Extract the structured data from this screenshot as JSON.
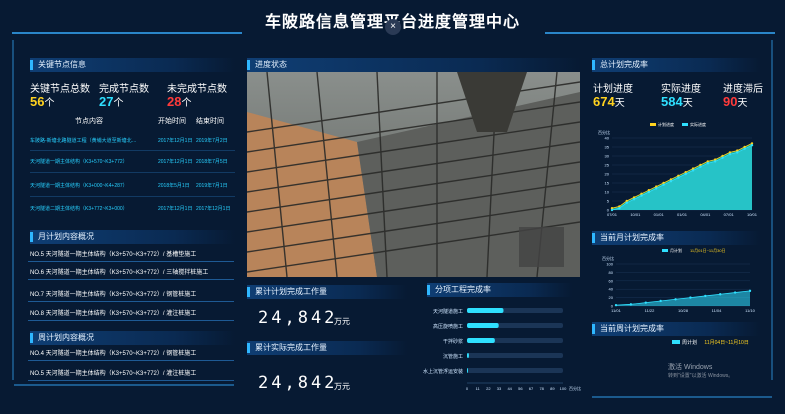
{
  "page": {
    "title": "车陂路信息管理平台进度管理中心",
    "close_glyph": "×"
  },
  "key_nodes": {
    "header": "关键节点信息",
    "stats": [
      {
        "label": "关键节点总数",
        "value": "56",
        "unit": "个",
        "color": "#ffd21f"
      },
      {
        "label": "完成节点数",
        "value": "27",
        "unit": "个",
        "color": "#2fe0ff"
      },
      {
        "label": "未完成节点数",
        "value": "28",
        "unit": "个",
        "color": "#ff3b3b"
      }
    ],
    "col_content": "节点内容",
    "col_start": "开始时间",
    "col_end": "结束时间",
    "rows": [
      {
        "content": "车陂路-新塘北路隧道工程（黄埔大道至新塘北…",
        "start": "2017年12月1日",
        "end": "2019年7月2日"
      },
      {
        "content": "天河隧道一期主体结构（K3+570~K3+772）",
        "start": "2017年12月1日",
        "end": "2018年7月5日"
      },
      {
        "content": "天河隧道一期主体结构（K3+000~K4+287）",
        "start": "2018年5月1日",
        "end": "2019年7月1日"
      },
      {
        "content": "天河隧道二期主体结构（K3+772~K3+000）",
        "start": "2017年12月1日",
        "end": "2017年12月1日"
      }
    ]
  },
  "monthly_plan": {
    "header": "月计划内容概况",
    "items": [
      "NO.5   天河隧道一期主体结构（K3+570~K3+772）/ 基槽垫施工",
      "NO.6   天河隧道一期主体结构（K3+570~K3+772）/ 三轴搅拌桩施工",
      "NO.7   天河隧道一期主体结构（K3+570~K3+772）/ 钢管桩施工",
      "NO.8   天河隧道一期主体结构（K3+570~K3+772）/ 灌注桩施工"
    ]
  },
  "weekly_plan": {
    "header": "周计划内容概况",
    "items": [
      "NO.4   天河隧道一期主体结构（K3+570~K3+772）/ 钢管桩施工",
      "NO.5   天河隧道一期主体结构（K3+570~K3+772）/ 灌注桩施工"
    ]
  },
  "progress_status": {
    "header": "进度状态"
  },
  "plan_workload": {
    "header": "累计计划完成工作量",
    "value": "24,842",
    "unit": "万元"
  },
  "actual_workload": {
    "header": "累计实际完成工作量",
    "value": "24,842",
    "unit": "万元"
  },
  "subitem": {
    "header": "分项工程完成率",
    "chart_data": {
      "type": "bar",
      "orientation": "horizontal",
      "categories": [
        "天河隧道施工",
        "高压旋喷施工",
        "干拌砂浆",
        "沉管施工",
        "水上沉管浮运安装"
      ],
      "values": [
        38,
        33,
        29,
        2,
        0
      ],
      "xticks": [
        "0",
        "11",
        "22",
        "33",
        "44",
        "56",
        "67",
        "78",
        "89",
        "100"
      ],
      "xlabel": "百分比",
      "xlim": [
        0,
        100
      ]
    }
  },
  "total_plan": {
    "header": "总计划完成率",
    "stats": [
      {
        "label": "计划进度",
        "value": "674",
        "unit": "天",
        "color": "#ffd21f"
      },
      {
        "label": "实际进度",
        "value": "584",
        "unit": "天",
        "color": "#2fe0ff"
      },
      {
        "label": "进度滞后",
        "value": "90",
        "unit": "天",
        "color": "#ff3b3b"
      }
    ],
    "chart_data": {
      "type": "area",
      "ylabel": "百分比",
      "ylim": [
        0,
        40
      ],
      "yticks": [
        "0",
        "5",
        "10",
        "15",
        "20",
        "25",
        "30",
        "35",
        "40"
      ],
      "xticks": [
        "07/01",
        "10/01",
        "01/01",
        "01/01",
        "04/01",
        "07/01",
        "10/01"
      ],
      "series": [
        {
          "name": "计划进度",
          "color": "#ffd21f",
          "values": [
            1,
            2,
            5,
            7,
            9,
            11,
            13,
            15,
            17,
            19,
            21,
            23,
            25,
            27,
            28,
            30,
            32,
            33,
            35,
            37
          ]
        },
        {
          "name": "实际进度",
          "color": "#2fe0ff",
          "values": [
            0,
            1,
            4,
            6,
            8,
            10,
            12,
            14,
            16,
            18,
            20,
            22,
            24,
            26,
            27,
            29,
            31,
            32,
            34,
            36
          ]
        }
      ]
    }
  },
  "month_plan": {
    "header": "当前月计划完成率",
    "legend": "月计划",
    "range": "11月01日~11月30日",
    "chart_data": {
      "type": "area",
      "ylabel": "百分比",
      "ylim": [
        0,
        100
      ],
      "yticks": [
        "0",
        "20",
        "40",
        "60",
        "80",
        "100"
      ],
      "xticks": [
        "11/01",
        "11/22",
        "10/28",
        "11/04",
        "11/10"
      ],
      "series": [
        {
          "name": "月计划",
          "color": "#2fe0ff",
          "values": [
            2,
            4,
            8,
            12,
            16,
            20,
            24,
            28,
            32,
            36
          ]
        }
      ]
    }
  },
  "week_plan": {
    "header": "当前周计划完成率",
    "legend": "周计划",
    "range": "11月04日~11月10日"
  },
  "watermark": {
    "line1": "激活 Windows",
    "line2": "转到\"设置\"以激活 Windows。"
  }
}
